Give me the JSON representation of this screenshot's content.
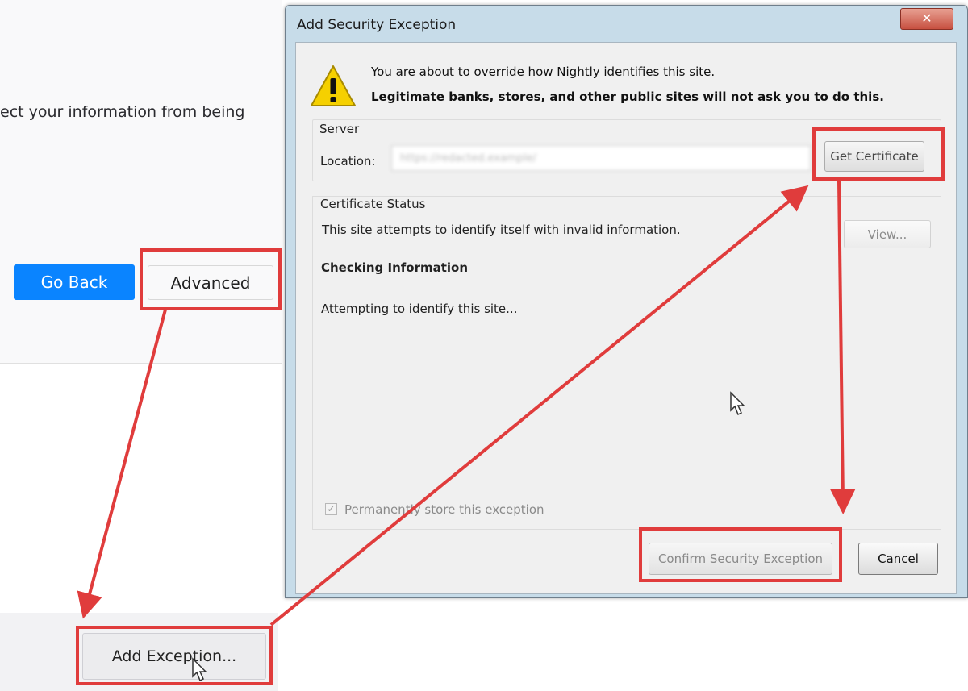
{
  "background_page": {
    "body_text": "ect your information from being",
    "go_back_label": "Go Back",
    "advanced_label": "Advanced",
    "add_exception_label": "Add Exception..."
  },
  "dialog": {
    "title": "Add Security Exception",
    "close_glyph": "✕",
    "warning_line1": "You are about to override how Nightly identifies this site.",
    "warning_line2": "Legitimate banks, stores, and other public sites will not ask you to do this.",
    "server_group_label": "Server",
    "location_label": "Location:",
    "location_value": "https://redacted.example/",
    "get_certificate_label": "Get Certificate",
    "certificate_status_label": "Certificate Status",
    "status_text": "This site attempts to identify itself with invalid information.",
    "view_label": "View...",
    "checking_heading": "Checking Information",
    "checking_text": "Attempting to identify this site...",
    "permanent_label": "Permanently store this exception",
    "permanent_checked": true,
    "confirm_label": "Confirm Security Exception",
    "cancel_label": "Cancel"
  },
  "colors": {
    "annotation": "#e03c3c",
    "go_back_bg": "#0a84ff",
    "dialog_frame": "#c7dce9"
  },
  "icons": [
    "warning-icon",
    "close-icon",
    "mouse-cursor-icon",
    "checkbox-check-icon"
  ]
}
